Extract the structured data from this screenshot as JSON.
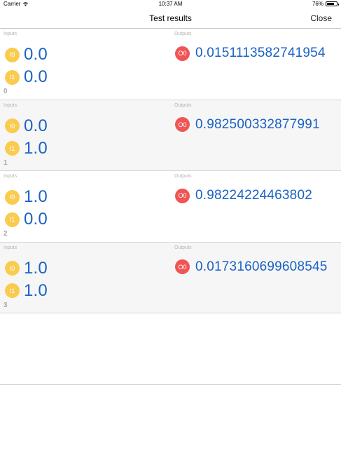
{
  "status_bar": {
    "carrier": "Carrier",
    "time": "10:37 AM",
    "battery": "76%",
    "battery_level": 0.76
  },
  "nav": {
    "title": "Test results",
    "close_label": "Close"
  },
  "labels": {
    "inputs": "Inputs",
    "outputs": "Outputs",
    "input_badges": [
      "I0",
      "I1"
    ],
    "output_badge": "O0"
  },
  "results": [
    {
      "index": "0",
      "inputs": [
        "0.0",
        "0.0"
      ],
      "output": "0.0151113582741954"
    },
    {
      "index": "1",
      "inputs": [
        "0.0",
        "1.0"
      ],
      "output": "0.982500332877991"
    },
    {
      "index": "2",
      "inputs": [
        "1.0",
        "0.0"
      ],
      "output": "0.98224224463802"
    },
    {
      "index": "3",
      "inputs": [
        "1.0",
        "1.0"
      ],
      "output": "0.0173160699608545"
    }
  ],
  "colors": {
    "input_badge": "#f9cc4f",
    "output_badge": "#f05555",
    "value_text": "#1a62c4",
    "row_shade": "#f6f6f6"
  }
}
